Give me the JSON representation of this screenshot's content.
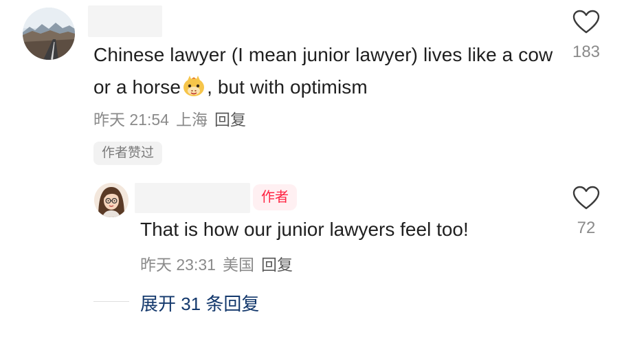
{
  "comment": {
    "text_part1": "Chinese lawyer (I mean junior lawyer) lives like a cow or a horse",
    "emoji": "horse-face-emoji",
    "text_part2": ", but with optimism",
    "date": "昨天 21:54",
    "location": "上海",
    "reply_label": "回复",
    "author_liked_label": "作者赞过",
    "like_count": "183"
  },
  "reply": {
    "author_badge": "作者",
    "text": "That is how our junior lawyers feel too!",
    "date": "昨天 23:31",
    "location": "美国",
    "reply_label": "回复",
    "like_count": "72"
  },
  "expand": {
    "label": "展开 31 条回复"
  },
  "colors": {
    "accent_red": "#ff2442",
    "expand_blue": "#13386c",
    "meta_gray": "#8a8a8a"
  }
}
